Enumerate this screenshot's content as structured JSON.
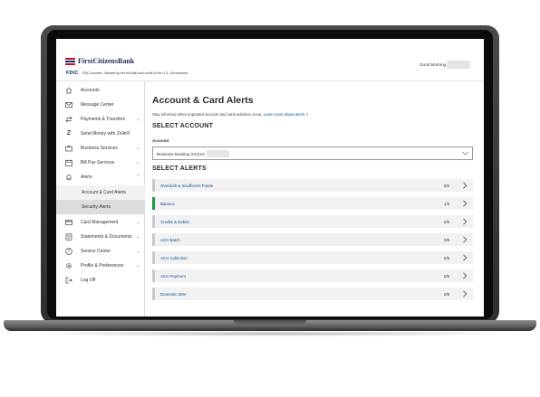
{
  "header": {
    "bank_name": "FirstCitizensBank",
    "fdic_badge": "FDIC",
    "fdic_text": "FDIC-Insured - Backed by the full faith and credit of the U.S. Government",
    "greeting": "Good Morning"
  },
  "sidebar": {
    "items": [
      {
        "label": "Accounts",
        "icon": "home-icon"
      },
      {
        "label": "Message Center",
        "icon": "envelope-icon"
      },
      {
        "label": "Payments & Transfers",
        "icon": "transfer-icon"
      },
      {
        "label": "Send Money with Zelle®",
        "icon": "zelle-icon"
      },
      {
        "label": "Business Services",
        "icon": "briefcase-icon"
      },
      {
        "label": "Bill Pay Services",
        "icon": "calendar-icon"
      },
      {
        "label": "Alerts",
        "icon": "bell-icon"
      },
      {
        "label": "Card Management",
        "icon": "card-icon"
      },
      {
        "label": "Statements & Documents",
        "icon": "document-icon"
      },
      {
        "label": "Service Center",
        "icon": "question-icon"
      },
      {
        "label": "Profile & Preferences",
        "icon": "gear-icon"
      },
      {
        "label": "Log Off",
        "icon": "logout-icon"
      }
    ],
    "alerts_subitems": [
      "Account & Card Alerts",
      "Security Alerts"
    ]
  },
  "main": {
    "title": "Account & Card Alerts",
    "intro": "Stay informed when important account and card activities occur.",
    "intro_link": "Learn more about alerts >",
    "select_account_heading": "SELECT ACCOUNT",
    "account_label": "Account",
    "account_value": "Business Banking XXXXX",
    "select_alerts_heading": "SELECT ALERTS",
    "alerts": [
      {
        "name": "Overdraft & Insufficient Funds",
        "count": "0/2",
        "enabled": false
      },
      {
        "name": "Balance",
        "count": "1/3",
        "enabled": true
      },
      {
        "name": "Credits & Debits",
        "count": "0/6",
        "enabled": false
      },
      {
        "name": "ACH Batch",
        "count": "0/5",
        "enabled": false
      },
      {
        "name": "ACH Collection",
        "count": "0/5",
        "enabled": false
      },
      {
        "name": "ACH Payment",
        "count": "0/5",
        "enabled": false
      },
      {
        "name": "Domestic Wire",
        "count": "0/5",
        "enabled": false
      }
    ]
  },
  "colors": {
    "brand_red": "#c8102e",
    "brand_navy": "#003b71",
    "link_blue": "#0a4f8f",
    "enabled_green": "#1a9b3b"
  }
}
